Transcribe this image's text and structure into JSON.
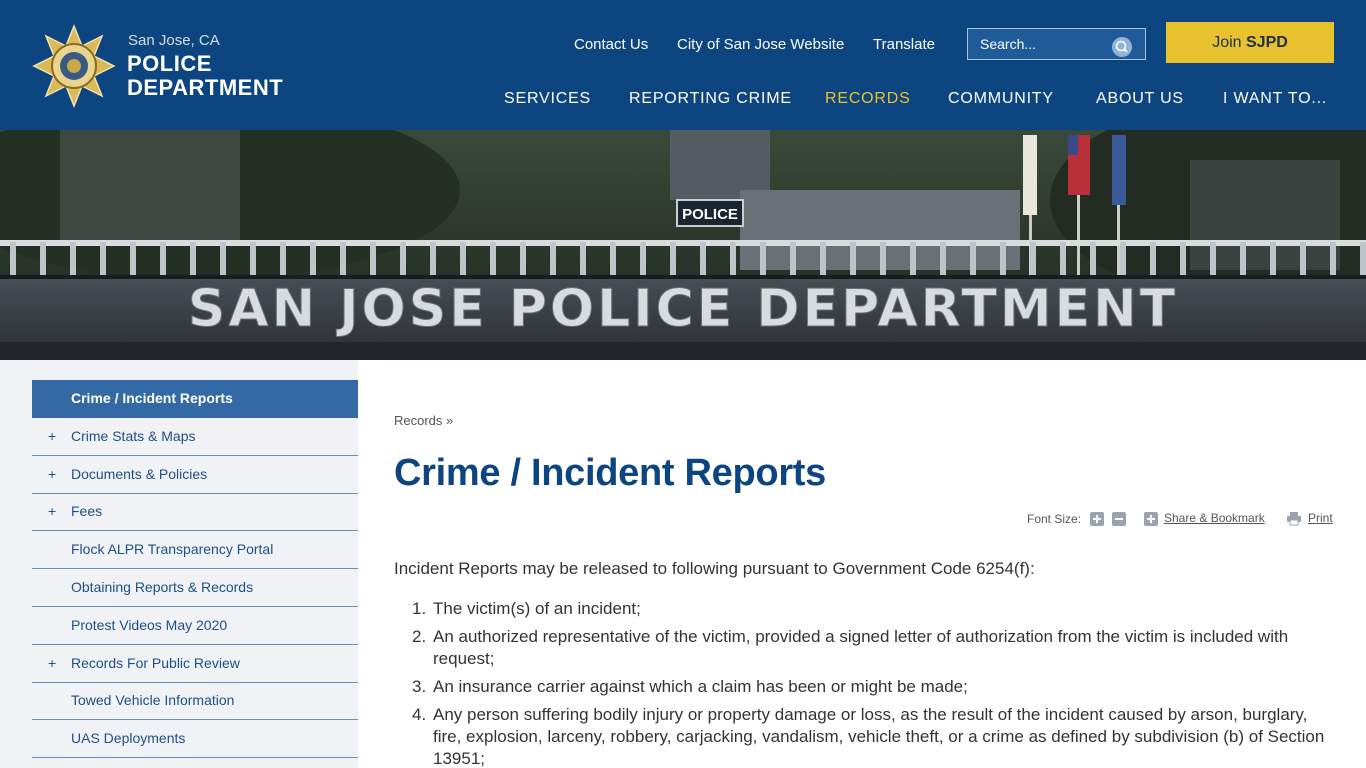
{
  "logo": {
    "city": "San Jose, CA",
    "line1": "POLICE",
    "line2": "DEPARTMENT"
  },
  "utility": {
    "contact": "Contact Us",
    "city_site": "City of San Jose Website",
    "translate": "Translate"
  },
  "search": {
    "placeholder": "Search..."
  },
  "join": {
    "prefix": "Join ",
    "brand": "SJPD"
  },
  "nav": [
    {
      "label": "SERVICES"
    },
    {
      "label": "REPORTING CRIME"
    },
    {
      "label": "RECORDS"
    },
    {
      "label": "COMMUNITY"
    },
    {
      "label": "ABOUT US"
    },
    {
      "label": "I WANT TO..."
    }
  ],
  "banner": {
    "building_sign": "SAN JOSE POLICE DEPARTMENT",
    "police_sign": "POLICE"
  },
  "sidebar": [
    {
      "label": "Crime / Incident Reports",
      "plus": ""
    },
    {
      "label": "Crime Stats & Maps",
      "plus": "+"
    },
    {
      "label": "Documents & Policies",
      "plus": "+"
    },
    {
      "label": "Fees",
      "plus": "+"
    },
    {
      "label": "Flock ALPR Transparency Portal",
      "plus": ""
    },
    {
      "label": "Obtaining Reports & Records",
      "plus": ""
    },
    {
      "label": "Protest Videos May 2020",
      "plus": ""
    },
    {
      "label": "Records For Public Review",
      "plus": "+"
    },
    {
      "label": "Towed Vehicle Information",
      "plus": ""
    },
    {
      "label": "UAS Deployments",
      "plus": ""
    }
  ],
  "breadcrumb": "Records »",
  "page_title": "Crime / Incident Reports",
  "tools": {
    "font_size": "Font Size:",
    "share": "Share & Bookmark",
    "print": "Print"
  },
  "content": {
    "intro": "Incident Reports may be released to following pursuant to Government Code 6254(f):",
    "items": [
      {
        "num": "1.",
        "text": "The victim(s) of an incident;"
      },
      {
        "num": "2.",
        "text": "An authorized representative of the victim, provided a signed letter of authorization from the victim is included with request;"
      },
      {
        "num": "3.",
        "text": "An insurance carrier against which a claim has been or might be made;"
      },
      {
        "num": "4.",
        "text": "Any person suffering bodily injury or property damage or loss, as the result of the incident caused by arson, burglary, fire, explosion, larceny, robbery, carjacking, vandalism, vehicle theft, or a crime as defined by subdivision (b) of Section 13951;"
      }
    ]
  },
  "colors": {
    "header_blue": "#0d4580",
    "accent_gold": "#e8c12e",
    "sidebar_active": "#336aa5"
  }
}
